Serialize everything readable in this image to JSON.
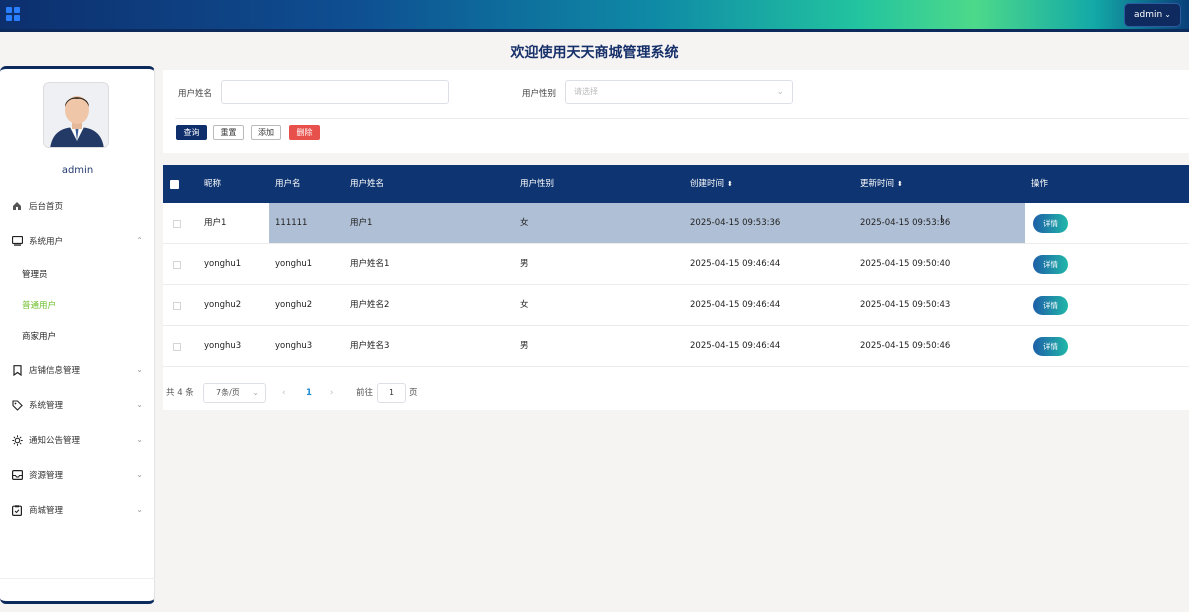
{
  "topbar": {
    "user_menu_label": "admin",
    "caret": "⌄"
  },
  "page": {
    "title": "欢迎使用天天商城管理系统"
  },
  "sidebar": {
    "username": "admin",
    "items": [
      {
        "label": "后台首页",
        "icon": "home-icon"
      },
      {
        "label": "系统用户",
        "icon": "monitor-icon",
        "expanded": true,
        "children": [
          {
            "label": "管理员"
          },
          {
            "label": "普通用户",
            "active": true
          },
          {
            "label": "商家用户"
          }
        ]
      },
      {
        "label": "店铺信息管理",
        "icon": "bookmark-icon"
      },
      {
        "label": "系统管理",
        "icon": "tag-icon"
      },
      {
        "label": "通知公告管理",
        "icon": "sun-icon"
      },
      {
        "label": "资源管理",
        "icon": "inbox-icon"
      },
      {
        "label": "商城管理",
        "icon": "clipboard-icon"
      }
    ]
  },
  "filters": {
    "name_label": "用户姓名",
    "name_value": "",
    "gender_label": "用户性别",
    "gender_placeholder": "请选择"
  },
  "actions": {
    "query": "查询",
    "reset": "重置",
    "add": "添加",
    "delete": "删除"
  },
  "table": {
    "headers": [
      "昵称",
      "用户名",
      "用户姓名",
      "用户性别",
      "创建时间",
      "更新时间",
      "操作"
    ],
    "sortable": [
      "创建时间",
      "更新时间"
    ],
    "detail_label": "详情",
    "rows": [
      {
        "nickname": "用户1",
        "username": "111111",
        "realname": "用户1",
        "gender": "女",
        "created": "2025-04-15 09:53:36",
        "updated": "2025-04-15 09:53:36",
        "highlighted": true
      },
      {
        "nickname": "yonghu1",
        "username": "yonghu1",
        "realname": "用户姓名1",
        "gender": "男",
        "created": "2025-04-15 09:46:44",
        "updated": "2025-04-15 09:50:40"
      },
      {
        "nickname": "yonghu2",
        "username": "yonghu2",
        "realname": "用户姓名2",
        "gender": "女",
        "created": "2025-04-15 09:46:44",
        "updated": "2025-04-15 09:50:43"
      },
      {
        "nickname": "yonghu3",
        "username": "yonghu3",
        "realname": "用户姓名3",
        "gender": "男",
        "created": "2025-04-15 09:46:44",
        "updated": "2025-04-15 09:50:46"
      }
    ]
  },
  "pagination": {
    "total_text": "共 4 条",
    "page_size": "7条/页",
    "current_page": "1",
    "goto_label": "前往",
    "goto_value": "1",
    "page_suffix": "页"
  },
  "colors": {
    "header_bg": "#0e3572",
    "active_menu": "#6cbf2a",
    "danger": "#e8504c",
    "primary": "#0e2f6c"
  }
}
